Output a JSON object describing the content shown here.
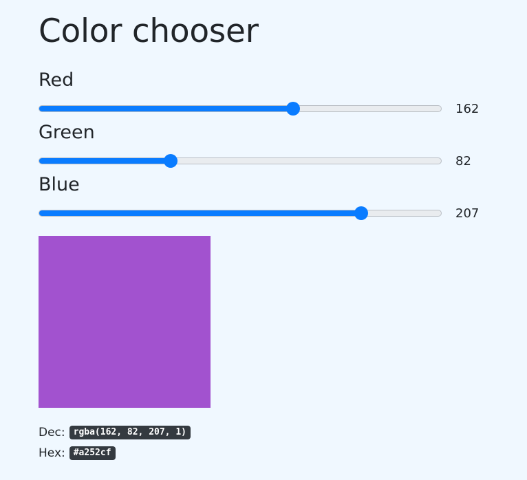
{
  "page": {
    "title": "Color chooser"
  },
  "channels": [
    {
      "label": "Red",
      "value": 162,
      "max": 255
    },
    {
      "label": "Green",
      "value": 82,
      "max": 255
    },
    {
      "label": "Blue",
      "value": 207,
      "max": 255
    }
  ],
  "colors": {
    "slider_accent": "#0a7cff",
    "swatch": "#a252cf",
    "page_background": "#f0f8ff"
  },
  "output": {
    "dec_label": "Dec:",
    "dec_value": "rgba(162, 82, 207, 1)",
    "hex_label": "Hex:",
    "hex_value": "#a252cf"
  }
}
